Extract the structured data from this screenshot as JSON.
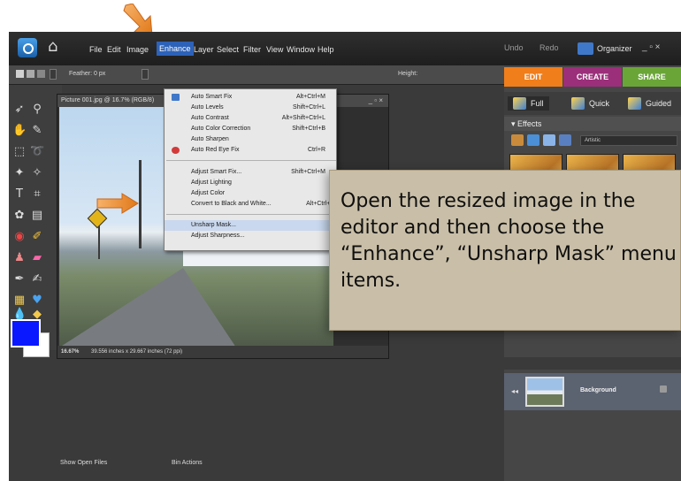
{
  "menubar": {
    "items": [
      "File",
      "Edit",
      "Image",
      "Enhance",
      "Layer",
      "Select",
      "Filter",
      "View",
      "Window",
      "Help"
    ],
    "undo": "Undo",
    "redo": "Redo",
    "organizer": "Organizer",
    "window_controls": "_ ▫ ×"
  },
  "optionsbar": {
    "feather": "Feather: 0 px",
    "height": "Height:"
  },
  "enhance_menu": {
    "items": [
      {
        "label": "Auto Smart Fix",
        "shortcut": "Alt+Ctrl+M"
      },
      {
        "label": "Auto Levels",
        "shortcut": "Shift+Ctrl+L"
      },
      {
        "label": "Auto Contrast",
        "shortcut": "Alt+Shift+Ctrl+L"
      },
      {
        "label": "Auto Color Correction",
        "shortcut": "Shift+Ctrl+B"
      },
      {
        "label": "Auto Sharpen",
        "shortcut": ""
      },
      {
        "label": "Auto Red Eye Fix",
        "shortcut": "Ctrl+R"
      },
      {
        "label": "Adjust Smart Fix...",
        "shortcut": "Shift+Ctrl+M"
      },
      {
        "label": "Adjust Lighting",
        "shortcut": ""
      },
      {
        "label": "Adjust Color",
        "shortcut": ""
      },
      {
        "label": "Convert to Black and White...",
        "shortcut": "Alt+Ctrl+B"
      },
      {
        "label": "Unsharp Mask...",
        "shortcut": ""
      },
      {
        "label": "Adjust Sharpness...",
        "shortcut": ""
      }
    ]
  },
  "document": {
    "title": "Picture 001.jpg @ 16.7% (RGB/8)",
    "controls": "_ ▫ ×",
    "zoom": "16.67%",
    "size": "39.556 inches x 29.667 inches (72 ppi)"
  },
  "right_panel": {
    "tabs": [
      "EDIT",
      "CREATE",
      "SHARE"
    ],
    "modes": [
      "Full",
      "Quick",
      "Guided"
    ],
    "effects_header": "Effects",
    "effects_category": "Artistic",
    "layer_name": "Background"
  },
  "bottom_bar": {
    "show_open_files": "Show Open Files",
    "bin_actions": "Bin Actions"
  },
  "callout": {
    "text": "Open the resized image in the editor and then choose the “Enhance”, “Unsharp Mask” menu items."
  },
  "colors": {
    "accent_orange": "#f07e1a",
    "menu_highlight": "#2d62b8",
    "foreground_swatch": "#0a18ff",
    "background_swatch": "#ffffff",
    "callout_bg": "#c9bea7"
  }
}
